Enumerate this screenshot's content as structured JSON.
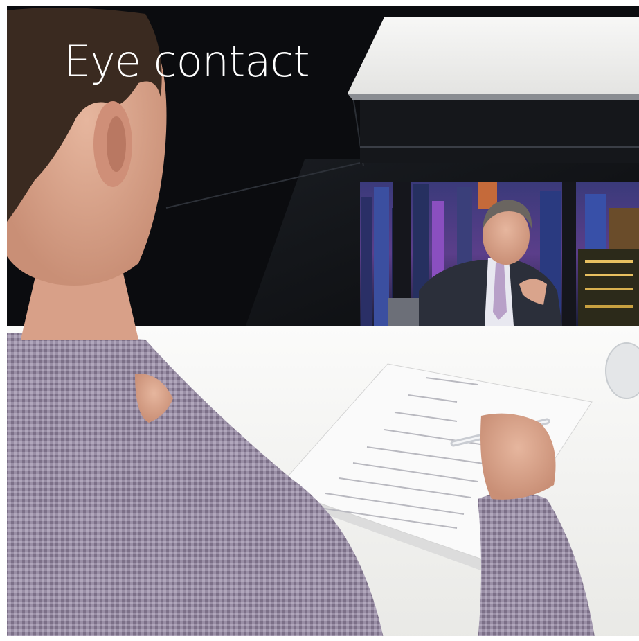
{
  "caption": {
    "text": "Eye contact"
  },
  "colors": {
    "background_dark": "#0b0c0f",
    "desk_surface": "#f2f2f0",
    "shirt_check": "#8c8198",
    "skin": "#d9a48c",
    "hair": "#3a2a20",
    "suit": "#2b2f3a",
    "city_glow": "#6a5ac8"
  },
  "scene": {
    "subjects": [
      "man-in-checked-shirt-foreground",
      "man-in-suit-on-screen"
    ],
    "objects": [
      "telepresence-screen",
      "overhead-hood",
      "document",
      "pen",
      "desk"
    ]
  }
}
